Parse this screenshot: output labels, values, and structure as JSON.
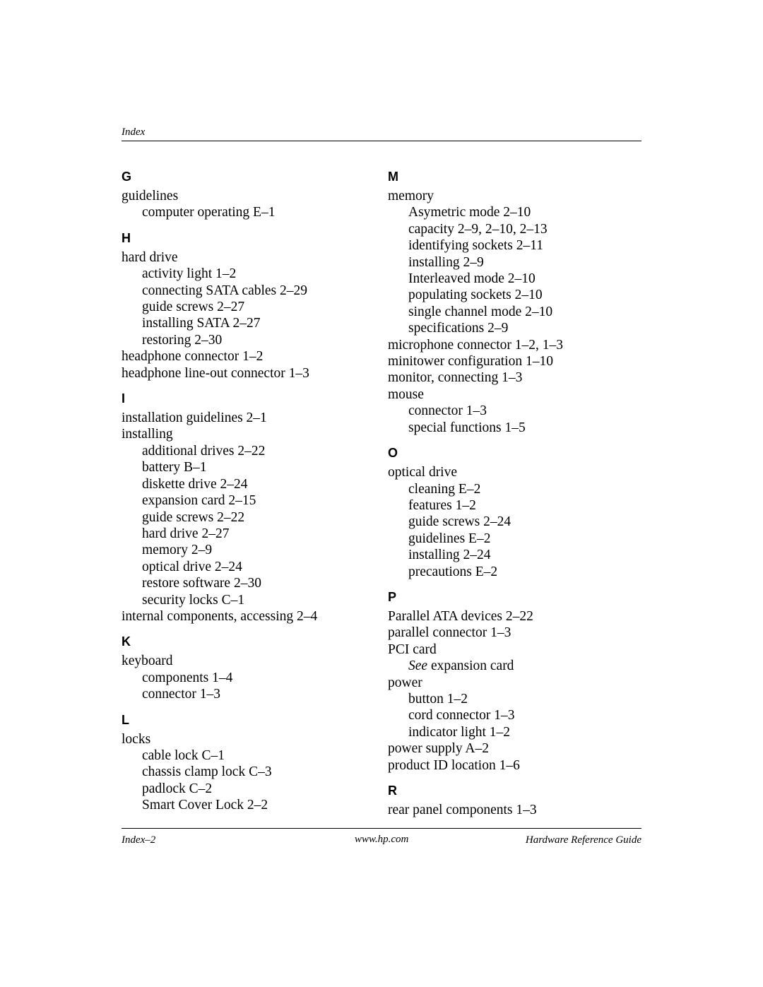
{
  "header": {
    "label": "Index"
  },
  "footer": {
    "left": "Index–2",
    "center": "www.hp.com",
    "right": "Hardware Reference Guide"
  },
  "columns": [
    {
      "sections": [
        {
          "letter": "G",
          "entries": [
            {
              "level": 1,
              "text": "guidelines"
            },
            {
              "level": 2,
              "text": "computer operating E–1"
            }
          ]
        },
        {
          "letter": "H",
          "entries": [
            {
              "level": 1,
              "text": "hard drive"
            },
            {
              "level": 2,
              "text": "activity light 1–2"
            },
            {
              "level": 2,
              "text": "connecting SATA cables 2–29"
            },
            {
              "level": 2,
              "text": "guide screws 2–27"
            },
            {
              "level": 2,
              "text": "installing SATA 2–27"
            },
            {
              "level": 2,
              "text": "restoring 2–30"
            },
            {
              "level": 1,
              "text": "headphone connector 1–2"
            },
            {
              "level": 1,
              "text": "headphone line-out connector 1–3"
            }
          ]
        },
        {
          "letter": "I",
          "entries": [
            {
              "level": 1,
              "text": "installation guidelines 2–1"
            },
            {
              "level": 1,
              "text": "installing"
            },
            {
              "level": 2,
              "text": "additional drives 2–22"
            },
            {
              "level": 2,
              "text": "battery B–1"
            },
            {
              "level": 2,
              "text": "diskette drive 2–24"
            },
            {
              "level": 2,
              "text": "expansion card 2–15"
            },
            {
              "level": 2,
              "text": "guide screws 2–22"
            },
            {
              "level": 2,
              "text": "hard drive 2–27"
            },
            {
              "level": 2,
              "text": "memory 2–9"
            },
            {
              "level": 2,
              "text": "optical drive 2–24"
            },
            {
              "level": 2,
              "text": "restore software 2–30"
            },
            {
              "level": 2,
              "text": "security locks C–1"
            },
            {
              "level": 1,
              "text": "internal components, accessing 2–4"
            }
          ]
        },
        {
          "letter": "K",
          "entries": [
            {
              "level": 1,
              "text": "keyboard"
            },
            {
              "level": 2,
              "text": "components 1–4"
            },
            {
              "level": 2,
              "text": "connector 1–3"
            }
          ]
        },
        {
          "letter": "L",
          "entries": [
            {
              "level": 1,
              "text": "locks"
            },
            {
              "level": 2,
              "text": "cable lock C–1"
            },
            {
              "level": 2,
              "text": "chassis clamp lock C–3"
            },
            {
              "level": 2,
              "text": "padlock C–2"
            },
            {
              "level": 2,
              "text": "Smart Cover Lock 2–2"
            }
          ]
        }
      ]
    },
    {
      "sections": [
        {
          "letter": "M",
          "entries": [
            {
              "level": 1,
              "text": "memory"
            },
            {
              "level": 2,
              "text": "Asymetric mode 2–10"
            },
            {
              "level": 2,
              "text": "capacity 2–9, 2–10, 2–13"
            },
            {
              "level": 2,
              "text": "identifying sockets 2–11"
            },
            {
              "level": 2,
              "text": "installing 2–9"
            },
            {
              "level": 2,
              "text": "Interleaved mode 2–10"
            },
            {
              "level": 2,
              "text": "populating sockets 2–10"
            },
            {
              "level": 2,
              "text": "single channel mode 2–10"
            },
            {
              "level": 2,
              "text": "specifications 2–9"
            },
            {
              "level": 1,
              "text": "microphone connector 1–2, 1–3"
            },
            {
              "level": 1,
              "text": "minitower configuration 1–10"
            },
            {
              "level": 1,
              "text": "monitor, connecting 1–3"
            },
            {
              "level": 1,
              "text": "mouse"
            },
            {
              "level": 2,
              "text": "connector 1–3"
            },
            {
              "level": 2,
              "text": "special functions 1–5"
            }
          ]
        },
        {
          "letter": "O",
          "entries": [
            {
              "level": 1,
              "text": "optical drive"
            },
            {
              "level": 2,
              "text": "cleaning E–2"
            },
            {
              "level": 2,
              "text": "features 1–2"
            },
            {
              "level": 2,
              "text": "guide screws 2–24"
            },
            {
              "level": 2,
              "text": "guidelines E–2"
            },
            {
              "level": 2,
              "text": "installing 2–24"
            },
            {
              "level": 2,
              "text": "precautions E–2"
            }
          ]
        },
        {
          "letter": "P",
          "entries": [
            {
              "level": 1,
              "text": "Parallel ATA devices 2–22"
            },
            {
              "level": 1,
              "text": "parallel connector 1–3"
            },
            {
              "level": 1,
              "text": "PCI card"
            },
            {
              "level": 2,
              "text": "See expansion card",
              "italic_prefix": "See"
            },
            {
              "level": 1,
              "text": "power"
            },
            {
              "level": 2,
              "text": "button 1–2"
            },
            {
              "level": 2,
              "text": "cord connector 1–3"
            },
            {
              "level": 2,
              "text": "indicator light 1–2"
            },
            {
              "level": 1,
              "text": "power supply A–2"
            },
            {
              "level": 1,
              "text": "product ID location 1–6"
            }
          ]
        },
        {
          "letter": "R",
          "entries": [
            {
              "level": 1,
              "text": "rear panel components 1–3"
            }
          ]
        }
      ]
    }
  ]
}
